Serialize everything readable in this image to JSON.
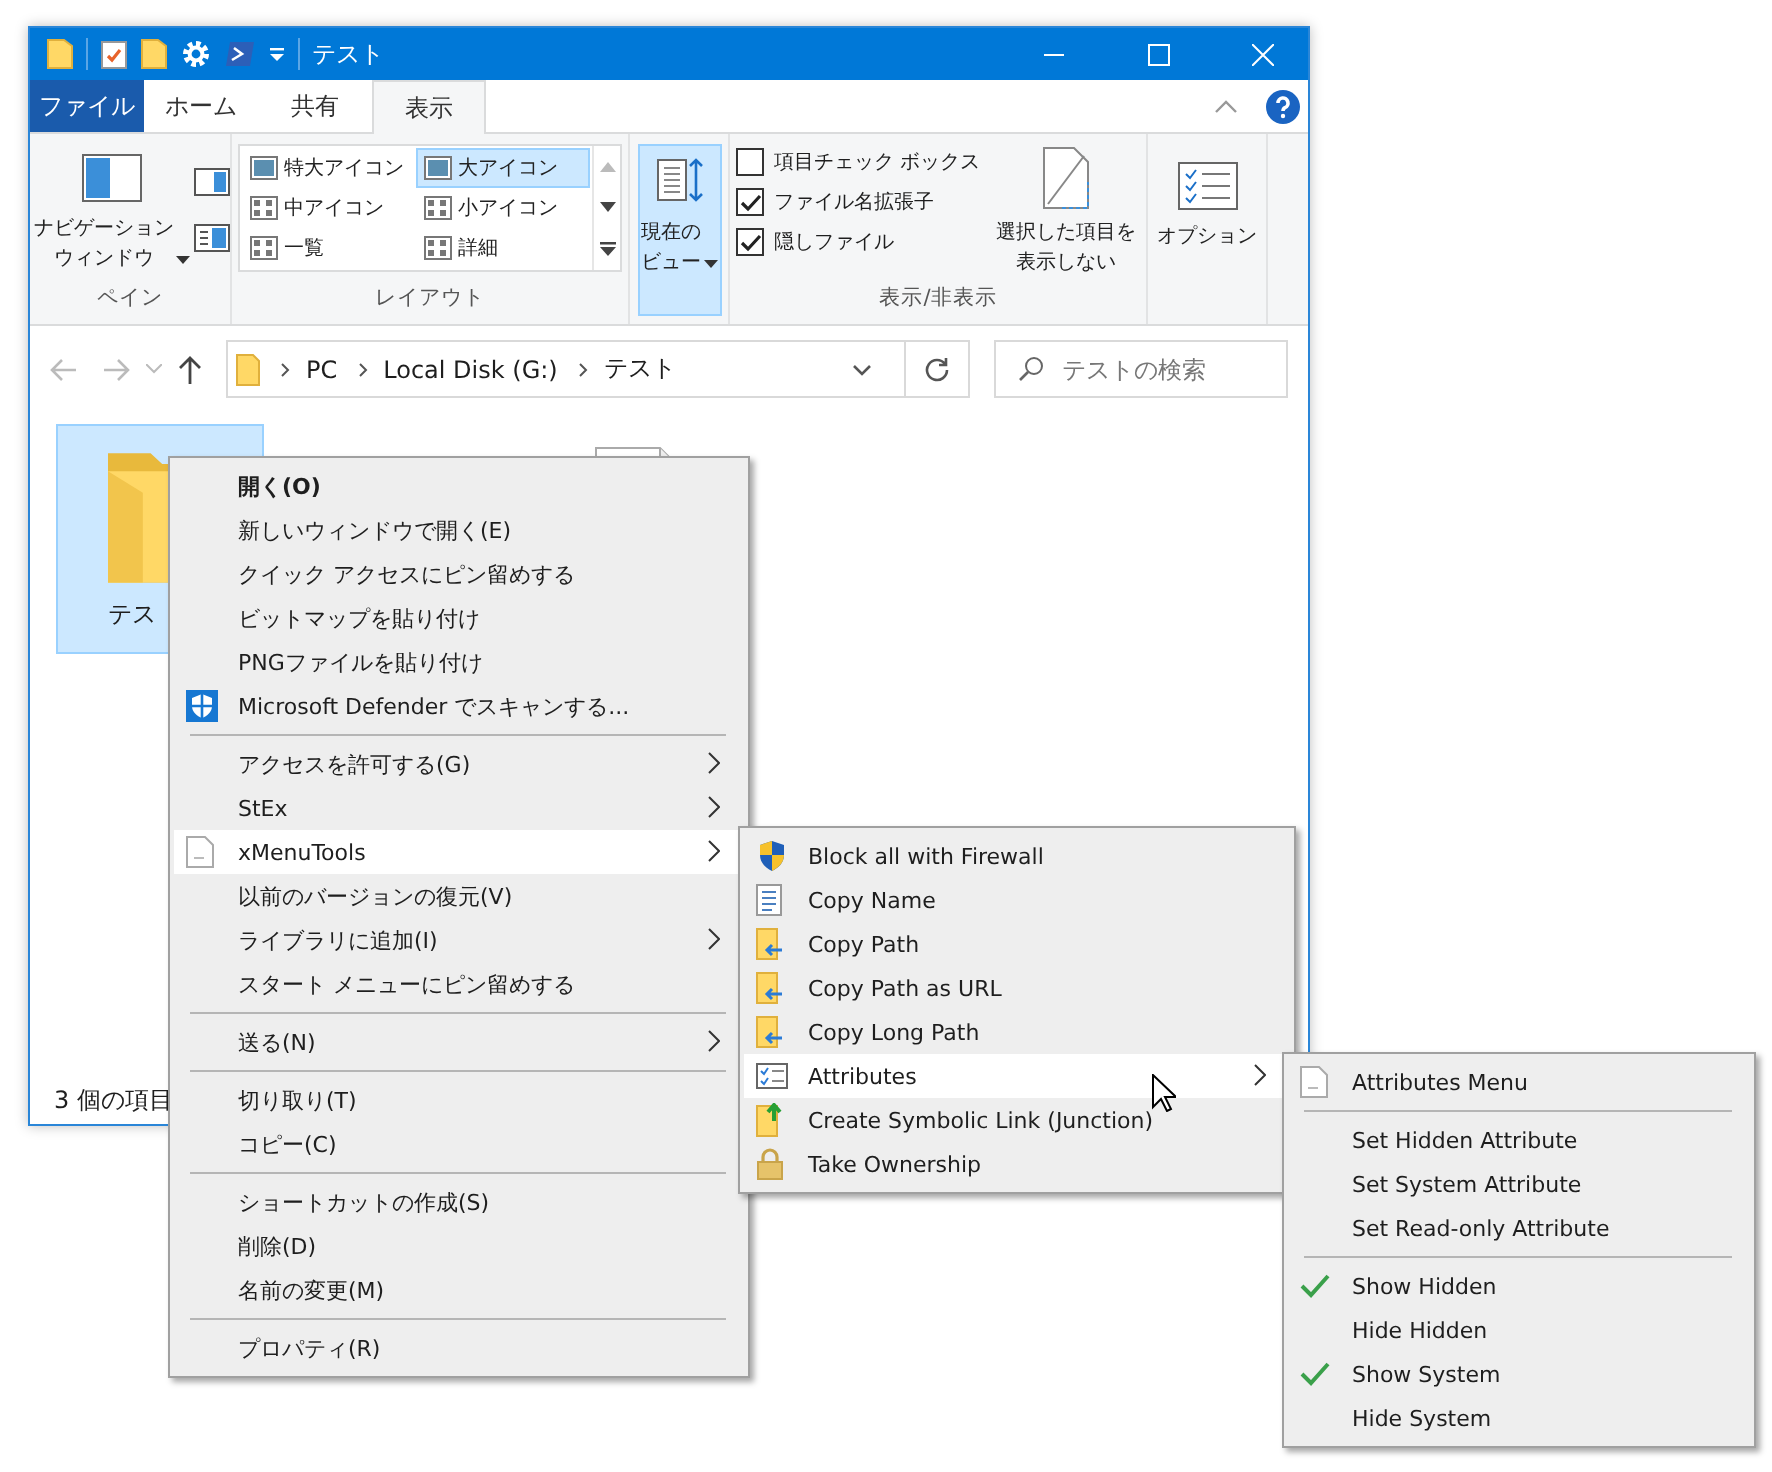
{
  "window": {
    "title": "テスト"
  },
  "tabs": [
    {
      "label": "ファイル",
      "kind": "file",
      "selected": false
    },
    {
      "label": "ホーム",
      "kind": "tab",
      "selected": false
    },
    {
      "label": "共有",
      "kind": "tab",
      "selected": false
    },
    {
      "label": "表示",
      "kind": "tab",
      "selected": true
    }
  ],
  "ribbon": {
    "pane": {
      "button": "ナビゲーションウィンドウ",
      "group": "ペイン"
    },
    "layout": {
      "group": "レイアウト",
      "items": [
        {
          "label": "特大アイコン",
          "selected": false
        },
        {
          "label": "大アイコン",
          "selected": true
        },
        {
          "label": "中アイコン",
          "selected": false
        },
        {
          "label": "小アイコン",
          "selected": false
        },
        {
          "label": "一覧",
          "selected": false
        },
        {
          "label": "詳細",
          "selected": false
        }
      ]
    },
    "current_view": {
      "label": "現在のビュー",
      "active": true
    },
    "show_hide": {
      "group": "表示/非表示",
      "checkboxes": [
        {
          "label": "項目チェック ボックス",
          "checked": false
        },
        {
          "label": "ファイル名拡張子",
          "checked": true
        },
        {
          "label": "隠しファイル",
          "checked": true
        }
      ],
      "hide_button": "選択した項目を表示しない"
    },
    "options": {
      "label": "オプション"
    }
  },
  "address": {
    "crumbs": [
      "PC",
      "Local Disk (G:)",
      "テスト"
    ],
    "search": {
      "placeholder": "テストの検索"
    }
  },
  "files": [
    {
      "label": "テス",
      "kind": "folder",
      "selected": true
    },
    {
      "kind": "file",
      "selected": false
    }
  ],
  "status_bar": "3 個の項目",
  "context_menu": {
    "items": [
      {
        "kind": "item",
        "label": "開く(O)",
        "default": true,
        "submenu": false,
        "highlighted": false
      },
      {
        "kind": "item",
        "label": "新しいウィンドウで開く(E)",
        "default": false,
        "submenu": false,
        "highlighted": false
      },
      {
        "kind": "item",
        "label": "クイック アクセスにピン留めする",
        "default": false,
        "submenu": false,
        "highlighted": false
      },
      {
        "kind": "item",
        "label": "ビットマップを貼り付け",
        "default": false,
        "submenu": false,
        "highlighted": false
      },
      {
        "kind": "item",
        "label": "PNGファイルを貼り付け",
        "default": false,
        "submenu": false,
        "highlighted": false
      },
      {
        "kind": "item",
        "label": "Microsoft Defender でスキャンする...",
        "default": false,
        "submenu": false,
        "highlighted": false
      },
      {
        "kind": "separator"
      },
      {
        "kind": "item",
        "label": "アクセスを許可する(G)",
        "default": false,
        "submenu": true,
        "highlighted": false
      },
      {
        "kind": "item",
        "label": "StEx",
        "default": false,
        "submenu": true,
        "highlighted": false
      },
      {
        "kind": "item",
        "label": "xMenuTools",
        "default": false,
        "submenu": true,
        "highlighted": true
      },
      {
        "kind": "item",
        "label": "以前のバージョンの復元(V)",
        "default": false,
        "submenu": false,
        "highlighted": false
      },
      {
        "kind": "item",
        "label": "ライブラリに追加(I)",
        "default": false,
        "submenu": true,
        "highlighted": false
      },
      {
        "kind": "item",
        "label": "スタート メニューにピン留めする",
        "default": false,
        "submenu": false,
        "highlighted": false
      },
      {
        "kind": "separator"
      },
      {
        "kind": "item",
        "label": "送る(N)",
        "default": false,
        "submenu": true,
        "highlighted": false
      },
      {
        "kind": "separator"
      },
      {
        "kind": "item",
        "label": "切り取り(T)",
        "default": false,
        "submenu": false,
        "highlighted": false
      },
      {
        "kind": "item",
        "label": "コピー(C)",
        "default": false,
        "submenu": false,
        "highlighted": false
      },
      {
        "kind": "separator"
      },
      {
        "kind": "item",
        "label": "ショートカットの作成(S)",
        "default": false,
        "submenu": false,
        "highlighted": false
      },
      {
        "kind": "item",
        "label": "削除(D)",
        "default": false,
        "submenu": false,
        "highlighted": false
      },
      {
        "kind": "item",
        "label": "名前の変更(M)",
        "default": false,
        "submenu": false,
        "highlighted": false
      },
      {
        "kind": "separator"
      },
      {
        "kind": "item",
        "label": "プロパティ(R)",
        "default": false,
        "submenu": false,
        "highlighted": false
      }
    ]
  },
  "submenu": {
    "items": [
      {
        "kind": "item",
        "label": "Block all with Firewall",
        "submenu": false,
        "highlighted": false
      },
      {
        "kind": "item",
        "label": "Copy Name",
        "submenu": false,
        "highlighted": false
      },
      {
        "kind": "item",
        "label": "Copy Path",
        "submenu": false,
        "highlighted": false
      },
      {
        "kind": "item",
        "label": "Copy Path as URL",
        "submenu": false,
        "highlighted": false
      },
      {
        "kind": "item",
        "label": "Copy Long Path",
        "submenu": false,
        "highlighted": false
      },
      {
        "kind": "item",
        "label": "Attributes",
        "submenu": true,
        "highlighted": true
      },
      {
        "kind": "item",
        "label": "Create Symbolic Link (Junction)",
        "submenu": false,
        "highlighted": false
      },
      {
        "kind": "item",
        "label": "Take Ownership",
        "submenu": false,
        "highlighted": false
      }
    ]
  },
  "attributes_menu": {
    "items": [
      {
        "kind": "item",
        "label": "Attributes Menu",
        "checked": false
      },
      {
        "kind": "separator"
      },
      {
        "kind": "item",
        "label": "Set Hidden Attribute",
        "checked": false
      },
      {
        "kind": "item",
        "label": "Set System Attribute",
        "checked": false
      },
      {
        "kind": "item",
        "label": "Set Read-only Attribute",
        "checked": false
      },
      {
        "kind": "separator"
      },
      {
        "kind": "item",
        "label": "Show Hidden",
        "checked": true
      },
      {
        "kind": "item",
        "label": "Hide Hidden",
        "checked": false
      },
      {
        "kind": "item",
        "label": "Show System",
        "checked": true
      },
      {
        "kind": "item",
        "label": "Hide System",
        "checked": false
      }
    ]
  }
}
